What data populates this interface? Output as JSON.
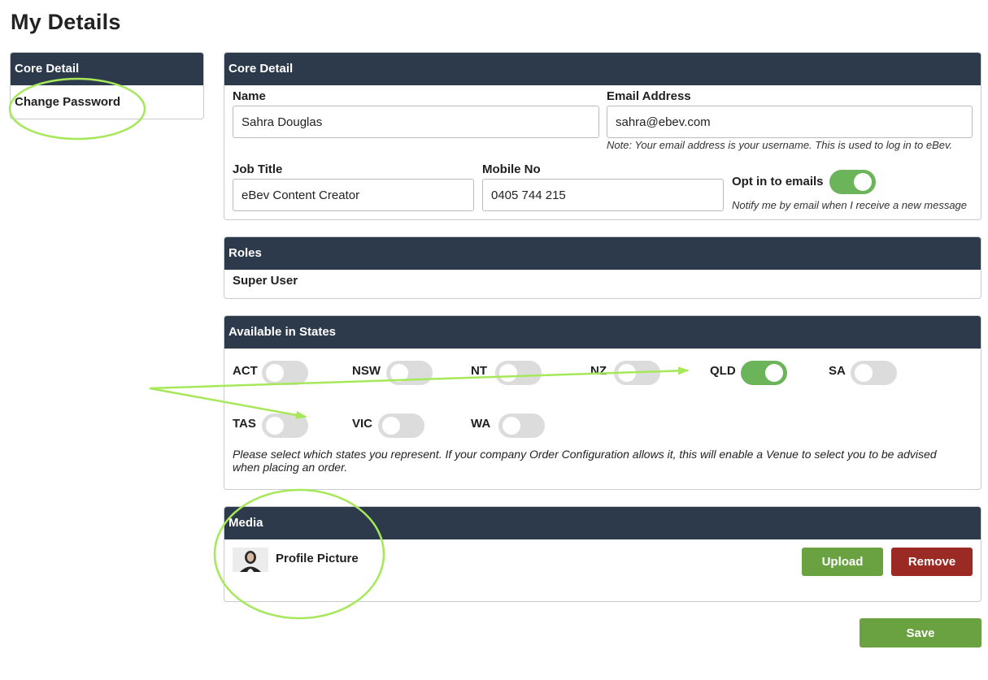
{
  "page": {
    "title": "My Details"
  },
  "nav": {
    "header": "Core Detail",
    "items": [
      {
        "label": "Change Password"
      }
    ]
  },
  "core": {
    "header": "Core Detail",
    "name": {
      "label": "Name",
      "value": "Sahra Douglas"
    },
    "email": {
      "label": "Email Address",
      "value": "sahra@ebev.com",
      "note": "Note: Your email address is your username. This is used to log in to eBev."
    },
    "job_title": {
      "label": "Job Title",
      "value": "eBev Content Creator"
    },
    "mobile": {
      "label": "Mobile No",
      "value": "0405 744 215"
    },
    "opt_in": {
      "label": "Opt in to emails",
      "enabled": true,
      "note": "Notify me by email when I receive a new message"
    }
  },
  "roles": {
    "header": "Roles",
    "value": "Super User"
  },
  "states": {
    "header": "Available in States",
    "items": [
      {
        "label": "ACT",
        "enabled": false
      },
      {
        "label": "NSW",
        "enabled": false
      },
      {
        "label": "NT",
        "enabled": false
      },
      {
        "label": "NZ",
        "enabled": false
      },
      {
        "label": "QLD",
        "enabled": true
      },
      {
        "label": "SA",
        "enabled": false
      },
      {
        "label": "TAS",
        "enabled": false
      },
      {
        "label": "VIC",
        "enabled": false
      },
      {
        "label": "WA",
        "enabled": false
      }
    ],
    "note": "Please select which states you represent. If your company Order Configuration allows it, this will enable a Venue to select you to be advised when placing an order."
  },
  "media": {
    "header": "Media",
    "profile_label": "Profile Picture",
    "upload_label": "Upload",
    "remove_label": "Remove"
  },
  "actions": {
    "save_label": "Save"
  },
  "colors": {
    "header_bg": "#2d3a4c",
    "toggle_on": "#6cb45a",
    "toggle_off": "#dcdcdc",
    "button_green": "#6aa242",
    "button_red": "#9c2a24",
    "annotation": "#a6e85a"
  }
}
